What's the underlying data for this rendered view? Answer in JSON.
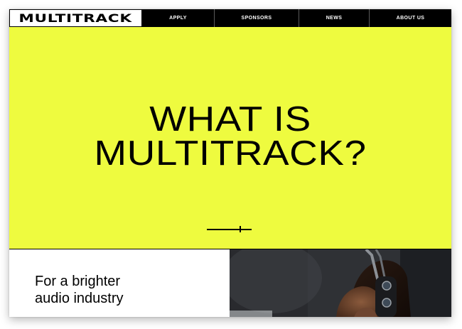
{
  "logo": "MULTITRACK",
  "nav": {
    "items": [
      "APPLY",
      "SPONSORS",
      "NEWS",
      "ABOUT US"
    ]
  },
  "hero": {
    "title_line1": "WHAT IS",
    "title_line2": "MULTITRACK?"
  },
  "tagline": {
    "line1": "For a brighter",
    "line2": "audio industry"
  },
  "colors": {
    "accent": "#eefb3f",
    "nav_bg": "#000000",
    "text": "#000000"
  }
}
